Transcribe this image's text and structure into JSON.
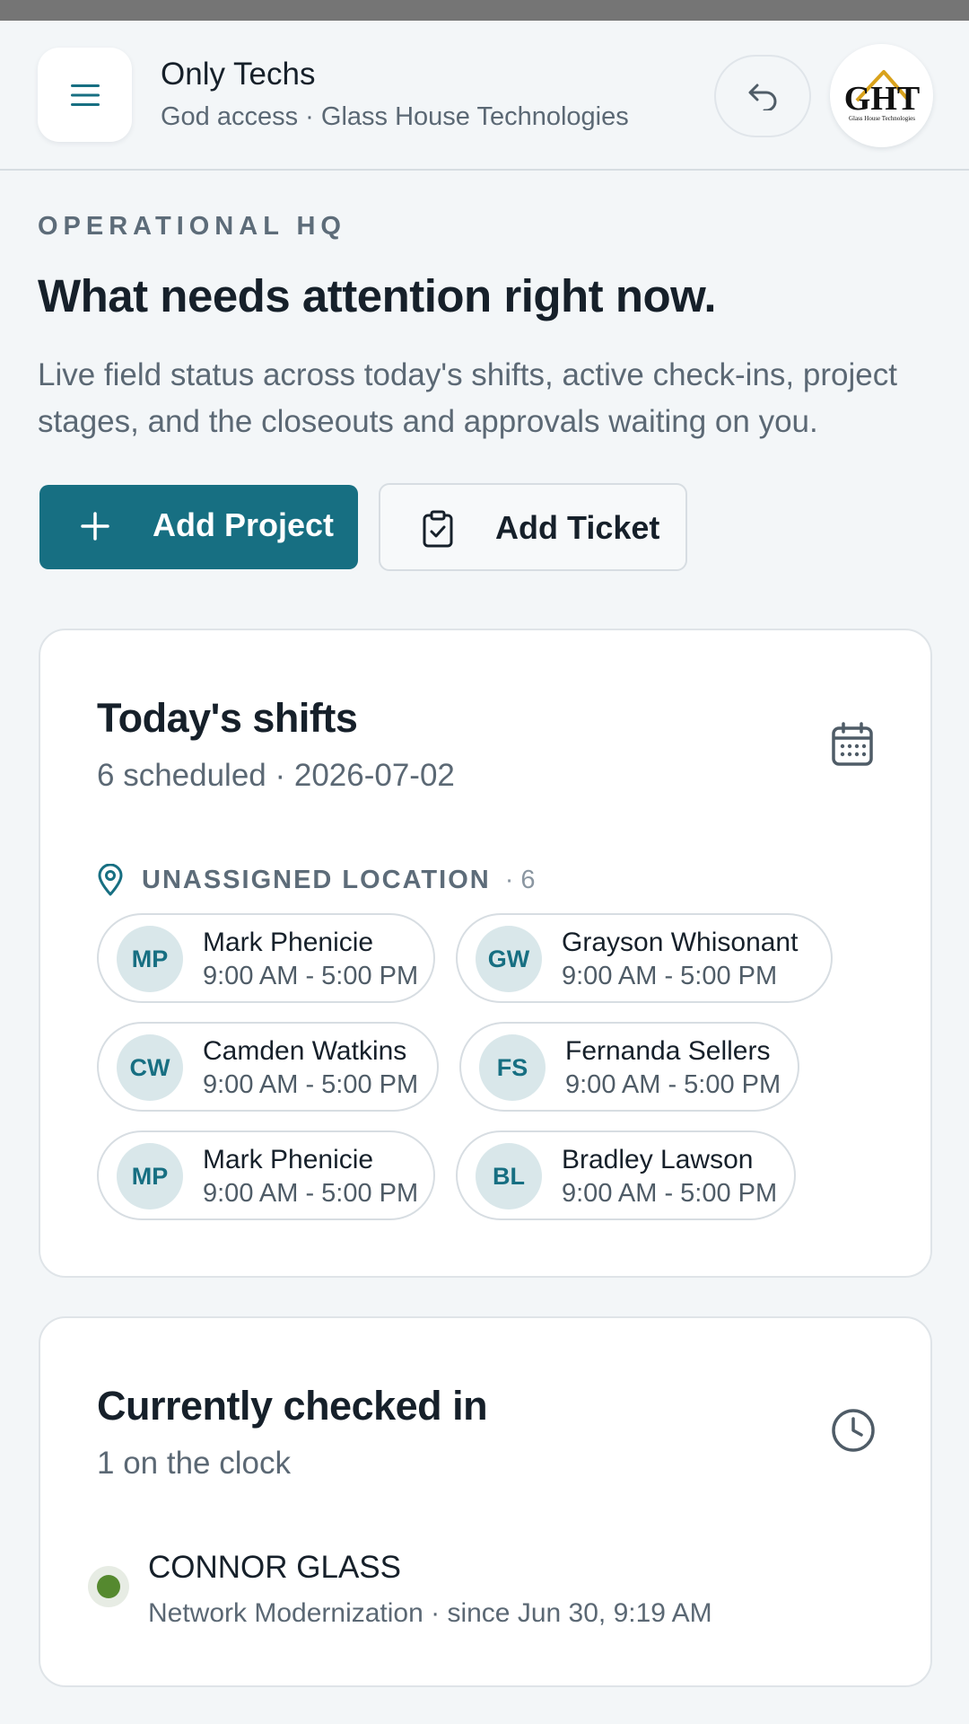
{
  "header": {
    "title": "Only Techs",
    "subtitle": "God access · Glass House Technologies",
    "logo_text": "GHT",
    "logo_caption": "Glass House Technologies",
    "menu_icon": "hamburger-menu-icon",
    "undo_icon": "undo-arrow-icon"
  },
  "hero": {
    "eyebrow": "OPERATIONAL HQ",
    "headline": "What needs attention right now.",
    "description": "Live field status across today's shifts, active check-ins, project stages, and the closeouts and approvals waiting on you.",
    "primary_button": "Add Project",
    "secondary_button": "Add Ticket"
  },
  "shifts": {
    "title": "Today's shifts",
    "subtitle": "6 scheduled · 2026-07-02",
    "location_label": "UNASSIGNED LOCATION",
    "location_count": "· 6",
    "people": [
      {
        "initials": "MP",
        "name": "Mark Phenicie",
        "time": "9:00 AM - 5:00 PM"
      },
      {
        "initials": "GW",
        "name": "Grayson Whisonant",
        "time": "9:00 AM - 5:00 PM"
      },
      {
        "initials": "CW",
        "name": "Camden Watkins",
        "time": "9:00 AM - 5:00 PM"
      },
      {
        "initials": "FS",
        "name": "Fernanda Sellers",
        "time": "9:00 AM - 5:00 PM"
      },
      {
        "initials": "MP",
        "name": "Mark Phenicie",
        "time": "9:00 AM - 5:00 PM"
      },
      {
        "initials": "BL",
        "name": "Bradley Lawson",
        "time": "9:00 AM - 5:00 PM"
      }
    ]
  },
  "checked_in": {
    "title": "Currently checked in",
    "subtitle": "1 on the clock",
    "entries": [
      {
        "name": "CONNOR GLASS",
        "meta": "Network Modernization · since Jun 30, 9:19 AM",
        "status_color": "#55892f"
      }
    ]
  },
  "colors": {
    "accent": "#176f82",
    "background": "#f3f6f8",
    "active_green": "#55892f",
    "logo_gold": "#d9a21b"
  }
}
